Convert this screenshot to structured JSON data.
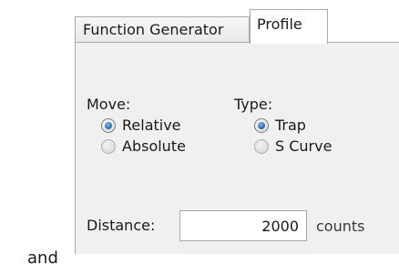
{
  "tabs": {
    "function_generator": "Function Generator",
    "profile": "Profile"
  },
  "move": {
    "label": "Move:",
    "options": [
      "Relative",
      "Absolute"
    ],
    "selected": "Relative"
  },
  "type": {
    "label": "Type:",
    "options": [
      "Trap",
      "S Curve"
    ],
    "selected": "Trap"
  },
  "distance": {
    "label": "Distance:",
    "value": "2000",
    "unit": "counts"
  },
  "footer_text": "and"
}
